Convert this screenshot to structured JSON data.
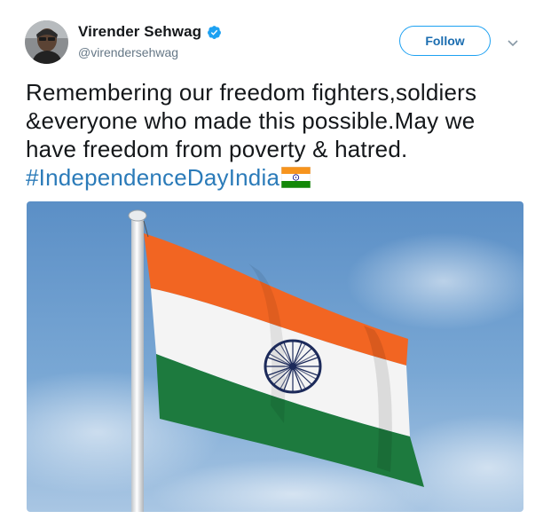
{
  "tweet": {
    "author": {
      "display_name": "Virender Sehwag",
      "handle": "@virendersehwag",
      "verified": true,
      "avatar_icon": "user-avatar-photo"
    },
    "follow_label": "Follow",
    "text_lines": [
      "Remembering our freedom fighters,soldiers",
      "&everyone who made this possible.May we",
      "have freedom from poverty & hatred."
    ],
    "hashtag": "#IndependenceDayIndia",
    "emoji_icon": "india-flag-emoji",
    "media": {
      "icon": "india-flag-photo"
    }
  },
  "colors": {
    "verified_blue": "#1da1f2",
    "hashtag_blue": "#2b7bb9",
    "follow_text": "#1b6db0",
    "handle_gray": "#657786",
    "saffron": "#f26522",
    "green": "#1d7a3e",
    "chakra_navy": "#1c2a5a",
    "sky": "#6f9fcf"
  }
}
